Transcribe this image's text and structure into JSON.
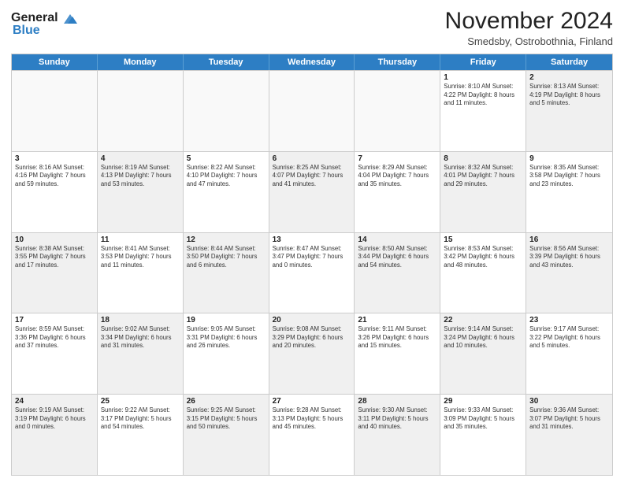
{
  "logo": {
    "line1": "General",
    "line2": "Blue"
  },
  "header": {
    "month": "November 2024",
    "location": "Smedsby, Ostrobothnia, Finland"
  },
  "weekdays": [
    "Sunday",
    "Monday",
    "Tuesday",
    "Wednesday",
    "Thursday",
    "Friday",
    "Saturday"
  ],
  "rows": [
    [
      {
        "day": "",
        "info": "",
        "shaded": false,
        "empty": true
      },
      {
        "day": "",
        "info": "",
        "shaded": false,
        "empty": true
      },
      {
        "day": "",
        "info": "",
        "shaded": false,
        "empty": true
      },
      {
        "day": "",
        "info": "",
        "shaded": false,
        "empty": true
      },
      {
        "day": "",
        "info": "",
        "shaded": false,
        "empty": true
      },
      {
        "day": "1",
        "info": "Sunrise: 8:10 AM\nSunset: 4:22 PM\nDaylight: 8 hours\nand 11 minutes.",
        "shaded": false,
        "empty": false
      },
      {
        "day": "2",
        "info": "Sunrise: 8:13 AM\nSunset: 4:19 PM\nDaylight: 8 hours\nand 5 minutes.",
        "shaded": true,
        "empty": false
      }
    ],
    [
      {
        "day": "3",
        "info": "Sunrise: 8:16 AM\nSunset: 4:16 PM\nDaylight: 7 hours\nand 59 minutes.",
        "shaded": false,
        "empty": false
      },
      {
        "day": "4",
        "info": "Sunrise: 8:19 AM\nSunset: 4:13 PM\nDaylight: 7 hours\nand 53 minutes.",
        "shaded": true,
        "empty": false
      },
      {
        "day": "5",
        "info": "Sunrise: 8:22 AM\nSunset: 4:10 PM\nDaylight: 7 hours\nand 47 minutes.",
        "shaded": false,
        "empty": false
      },
      {
        "day": "6",
        "info": "Sunrise: 8:25 AM\nSunset: 4:07 PM\nDaylight: 7 hours\nand 41 minutes.",
        "shaded": true,
        "empty": false
      },
      {
        "day": "7",
        "info": "Sunrise: 8:29 AM\nSunset: 4:04 PM\nDaylight: 7 hours\nand 35 minutes.",
        "shaded": false,
        "empty": false
      },
      {
        "day": "8",
        "info": "Sunrise: 8:32 AM\nSunset: 4:01 PM\nDaylight: 7 hours\nand 29 minutes.",
        "shaded": true,
        "empty": false
      },
      {
        "day": "9",
        "info": "Sunrise: 8:35 AM\nSunset: 3:58 PM\nDaylight: 7 hours\nand 23 minutes.",
        "shaded": false,
        "empty": false
      }
    ],
    [
      {
        "day": "10",
        "info": "Sunrise: 8:38 AM\nSunset: 3:55 PM\nDaylight: 7 hours\nand 17 minutes.",
        "shaded": true,
        "empty": false
      },
      {
        "day": "11",
        "info": "Sunrise: 8:41 AM\nSunset: 3:53 PM\nDaylight: 7 hours\nand 11 minutes.",
        "shaded": false,
        "empty": false
      },
      {
        "day": "12",
        "info": "Sunrise: 8:44 AM\nSunset: 3:50 PM\nDaylight: 7 hours\nand 6 minutes.",
        "shaded": true,
        "empty": false
      },
      {
        "day": "13",
        "info": "Sunrise: 8:47 AM\nSunset: 3:47 PM\nDaylight: 7 hours\nand 0 minutes.",
        "shaded": false,
        "empty": false
      },
      {
        "day": "14",
        "info": "Sunrise: 8:50 AM\nSunset: 3:44 PM\nDaylight: 6 hours\nand 54 minutes.",
        "shaded": true,
        "empty": false
      },
      {
        "day": "15",
        "info": "Sunrise: 8:53 AM\nSunset: 3:42 PM\nDaylight: 6 hours\nand 48 minutes.",
        "shaded": false,
        "empty": false
      },
      {
        "day": "16",
        "info": "Sunrise: 8:56 AM\nSunset: 3:39 PM\nDaylight: 6 hours\nand 43 minutes.",
        "shaded": true,
        "empty": false
      }
    ],
    [
      {
        "day": "17",
        "info": "Sunrise: 8:59 AM\nSunset: 3:36 PM\nDaylight: 6 hours\nand 37 minutes.",
        "shaded": false,
        "empty": false
      },
      {
        "day": "18",
        "info": "Sunrise: 9:02 AM\nSunset: 3:34 PM\nDaylight: 6 hours\nand 31 minutes.",
        "shaded": true,
        "empty": false
      },
      {
        "day": "19",
        "info": "Sunrise: 9:05 AM\nSunset: 3:31 PM\nDaylight: 6 hours\nand 26 minutes.",
        "shaded": false,
        "empty": false
      },
      {
        "day": "20",
        "info": "Sunrise: 9:08 AM\nSunset: 3:29 PM\nDaylight: 6 hours\nand 20 minutes.",
        "shaded": true,
        "empty": false
      },
      {
        "day": "21",
        "info": "Sunrise: 9:11 AM\nSunset: 3:26 PM\nDaylight: 6 hours\nand 15 minutes.",
        "shaded": false,
        "empty": false
      },
      {
        "day": "22",
        "info": "Sunrise: 9:14 AM\nSunset: 3:24 PM\nDaylight: 6 hours\nand 10 minutes.",
        "shaded": true,
        "empty": false
      },
      {
        "day": "23",
        "info": "Sunrise: 9:17 AM\nSunset: 3:22 PM\nDaylight: 6 hours\nand 5 minutes.",
        "shaded": false,
        "empty": false
      }
    ],
    [
      {
        "day": "24",
        "info": "Sunrise: 9:19 AM\nSunset: 3:19 PM\nDaylight: 6 hours\nand 0 minutes.",
        "shaded": true,
        "empty": false
      },
      {
        "day": "25",
        "info": "Sunrise: 9:22 AM\nSunset: 3:17 PM\nDaylight: 5 hours\nand 54 minutes.",
        "shaded": false,
        "empty": false
      },
      {
        "day": "26",
        "info": "Sunrise: 9:25 AM\nSunset: 3:15 PM\nDaylight: 5 hours\nand 50 minutes.",
        "shaded": true,
        "empty": false
      },
      {
        "day": "27",
        "info": "Sunrise: 9:28 AM\nSunset: 3:13 PM\nDaylight: 5 hours\nand 45 minutes.",
        "shaded": false,
        "empty": false
      },
      {
        "day": "28",
        "info": "Sunrise: 9:30 AM\nSunset: 3:11 PM\nDaylight: 5 hours\nand 40 minutes.",
        "shaded": true,
        "empty": false
      },
      {
        "day": "29",
        "info": "Sunrise: 9:33 AM\nSunset: 3:09 PM\nDaylight: 5 hours\nand 35 minutes.",
        "shaded": false,
        "empty": false
      },
      {
        "day": "30",
        "info": "Sunrise: 9:36 AM\nSunset: 3:07 PM\nDaylight: 5 hours\nand 31 minutes.",
        "shaded": true,
        "empty": false
      }
    ]
  ]
}
